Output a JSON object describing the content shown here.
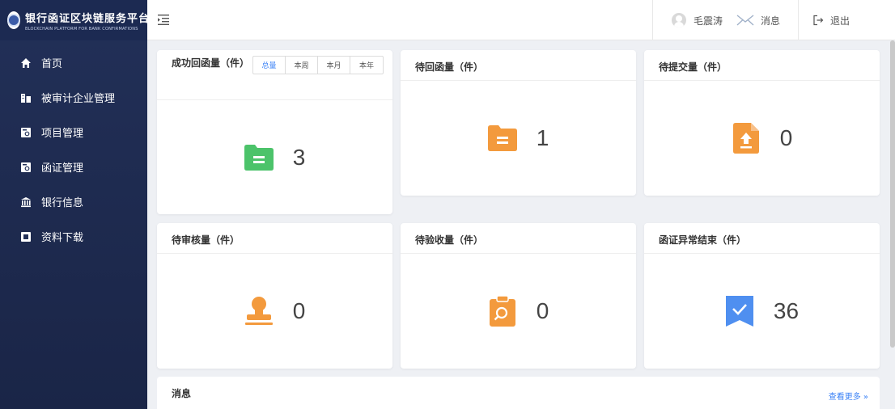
{
  "brand": {
    "title": "银行函证区块链服务平台",
    "subtitle": "BLOCKCHAIN PLATFORM FOR BANK CONFIRMATIONS"
  },
  "sidebar": {
    "items": [
      {
        "label": "首页",
        "icon": "home-icon"
      },
      {
        "label": "被审计企业管理",
        "icon": "building-icon"
      },
      {
        "label": "项目管理",
        "icon": "project-icon"
      },
      {
        "label": "函证管理",
        "icon": "letter-icon"
      },
      {
        "label": "银行信息",
        "icon": "bank-icon"
      },
      {
        "label": "资料下载",
        "icon": "download-icon"
      }
    ]
  },
  "header": {
    "user_name": "毛震涛",
    "messages_label": "消息",
    "logout_label": "退出"
  },
  "cards": {
    "success": {
      "title": "成功回函量（件）",
      "value": "3",
      "tabs": [
        "总量",
        "本周",
        "本月",
        "本年"
      ],
      "active_tab": "总量"
    },
    "pending_reply": {
      "title": "待回函量（件）",
      "value": "1"
    },
    "pending_submit": {
      "title": "待提交量（件）",
      "value": "0"
    },
    "pending_review": {
      "title": "待审核量（件）",
      "value": "0"
    },
    "pending_accept": {
      "title": "待验收量（件）",
      "value": "0"
    },
    "abnormal_end": {
      "title": "函证异常结束（件）",
      "value": "36"
    }
  },
  "messages": {
    "title": "消息",
    "more_label": "查看更多 »"
  },
  "colors": {
    "sidebar_bg": "#223058",
    "green": "#4cc36a",
    "orange": "#f39a3d",
    "blue": "#3b82f6",
    "badge_blue": "#4f8ff0"
  }
}
